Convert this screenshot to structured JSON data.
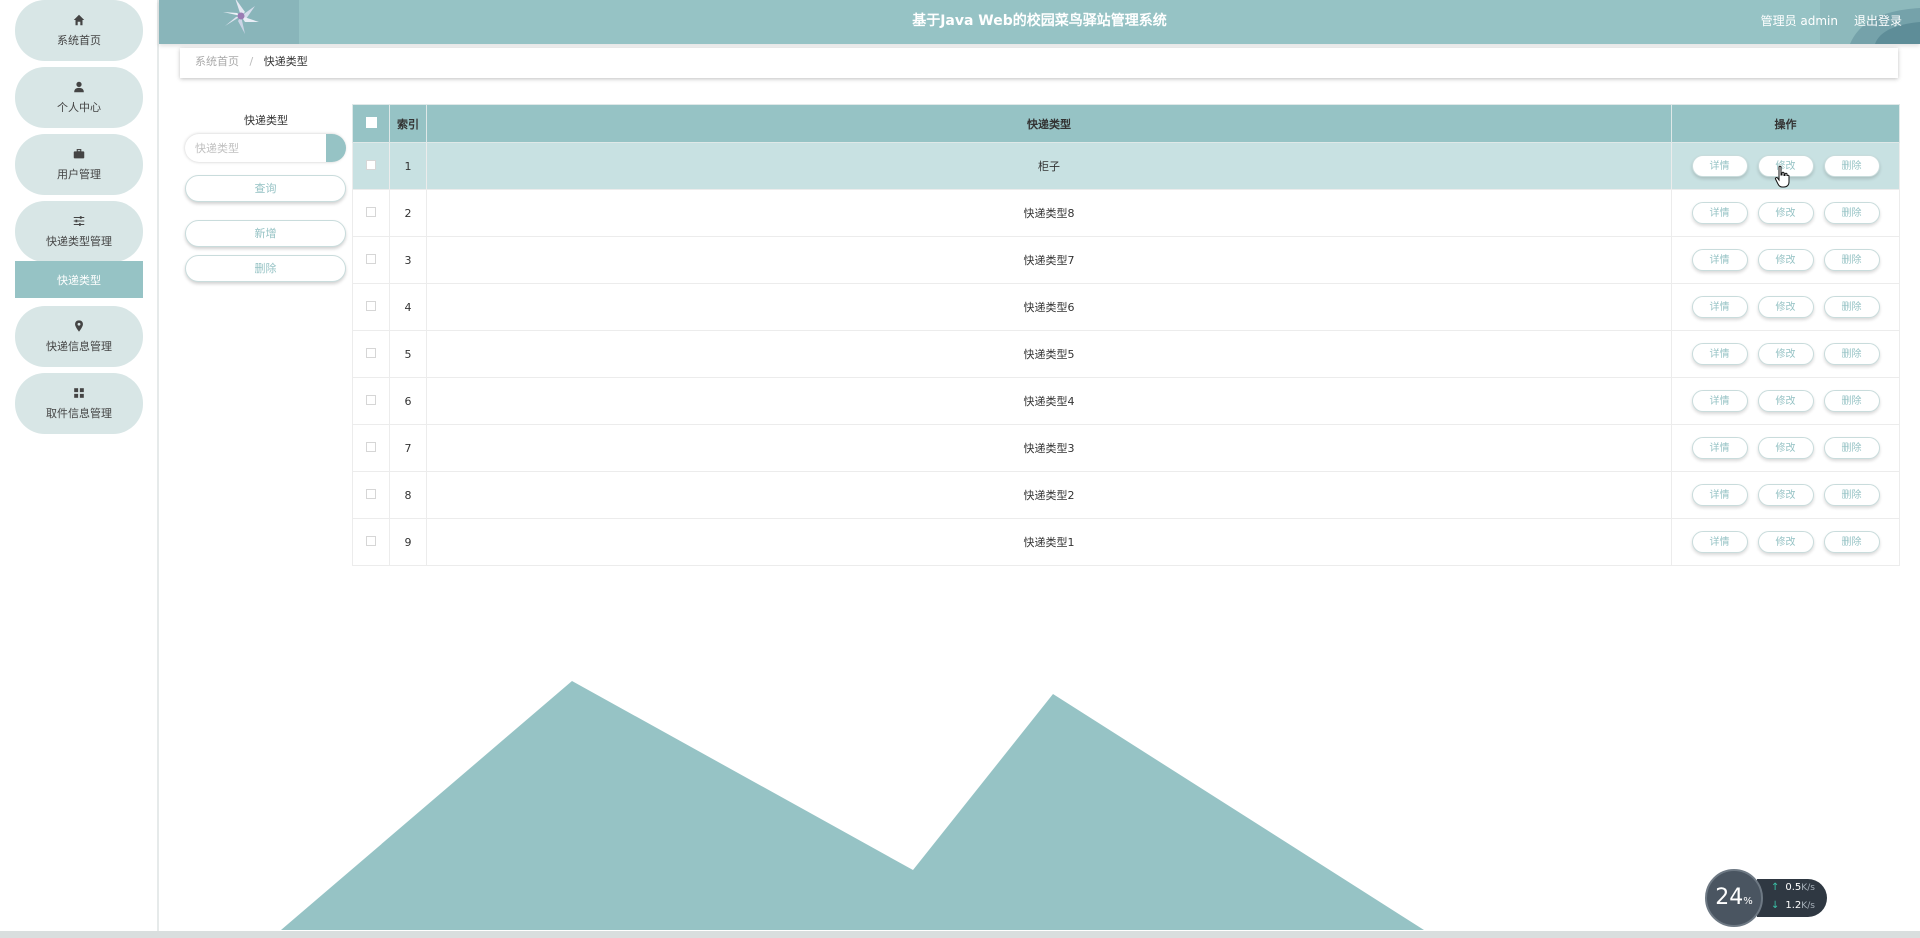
{
  "header": {
    "title": "基于Java Web的校园菜鸟驿站管理系统",
    "user_label": "管理员 admin",
    "logout": "退出登录"
  },
  "sidebar": {
    "items": [
      {
        "label": "系统首页",
        "icon": "home-icon"
      },
      {
        "label": "个人中心",
        "icon": "user-icon"
      },
      {
        "label": "用户管理",
        "icon": "briefcase-icon"
      },
      {
        "label": "快递类型管理",
        "icon": "sliders-icon"
      },
      {
        "label": "快递信息管理",
        "icon": "map-pin-icon"
      },
      {
        "label": "取件信息管理",
        "icon": "grid-icon"
      }
    ],
    "active_sub": "快递类型"
  },
  "breadcrumb": {
    "home": "系统首页",
    "separator": "/",
    "current": "快递类型"
  },
  "search": {
    "label": "快递类型",
    "placeholder": "快递类型",
    "query_button": "查询",
    "add_button": "新增",
    "delete_button": "删除"
  },
  "table": {
    "headers": [
      "索引",
      "快递类型",
      "操作"
    ],
    "actions": [
      "详情",
      "修改",
      "删除"
    ],
    "rows": [
      {
        "index": "1",
        "type": "柜子"
      },
      {
        "index": "2",
        "type": "快递类型8"
      },
      {
        "index": "3",
        "type": "快递类型7"
      },
      {
        "index": "4",
        "type": "快递类型6"
      },
      {
        "index": "5",
        "type": "快递类型5"
      },
      {
        "index": "6",
        "type": "快递类型4"
      },
      {
        "index": "7",
        "type": "快递类型3"
      },
      {
        "index": "8",
        "type": "快递类型2"
      },
      {
        "index": "9",
        "type": "快递类型1"
      }
    ],
    "highlighted_row": 0
  },
  "speed_widget": {
    "percent": "24",
    "percent_sign": "%",
    "upload": "0.5",
    "download": "1.2",
    "unit": "K/s"
  },
  "colors": {
    "accent": "#96c3c5",
    "nav_bg": "#d8e6e6",
    "row_highlight": "#c8e1e2"
  }
}
